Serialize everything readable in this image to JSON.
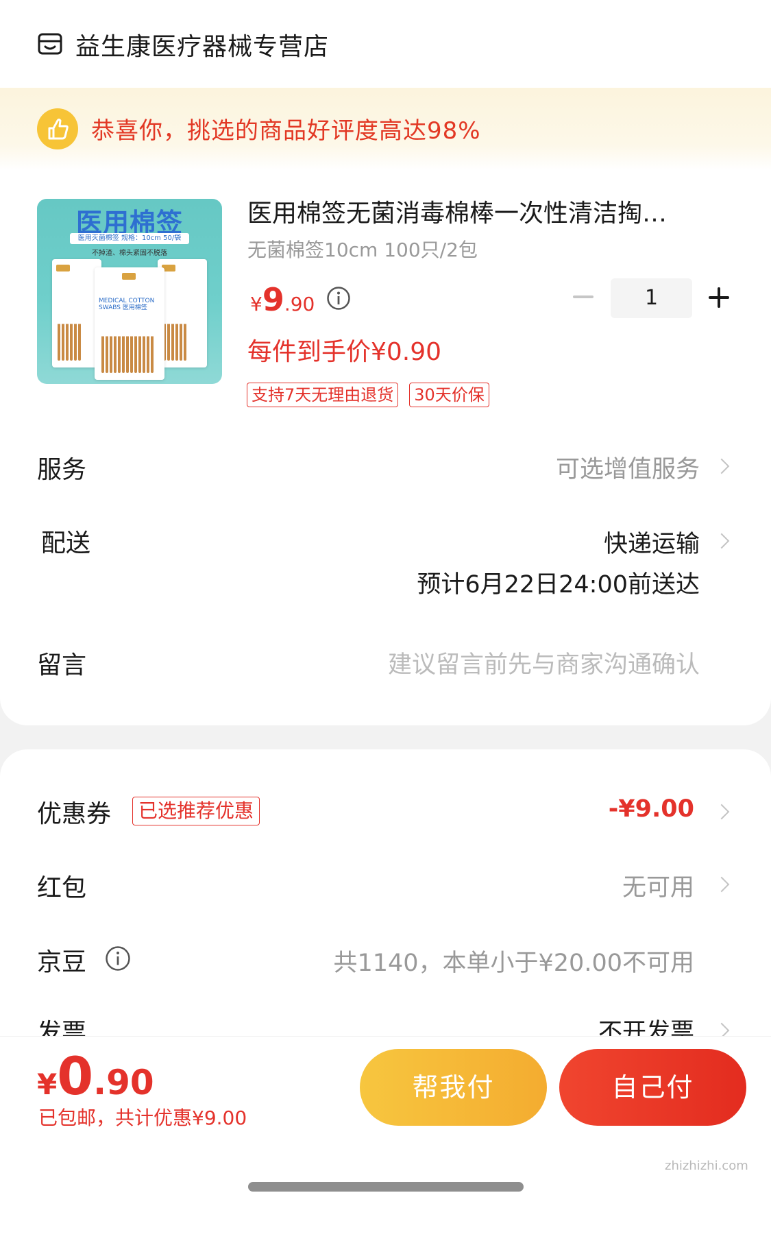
{
  "store": {
    "name": "益生康医疗器械专营店",
    "icon": "store-icon"
  },
  "praise": {
    "text": "恭喜你，挑选的商品好评度高达98%",
    "icon": "thumbs-up-icon"
  },
  "product": {
    "image_text": {
      "title": "医用棉签",
      "sub": "医用灭菌棉签  规格：10cm 50/袋",
      "sub2": "不掉渣、棉头紧固不脱落",
      "pack_label": "MEDICAL COTTON SWABS 医用棉签"
    },
    "title": "医用棉签无菌消毒棉棒一次性清洁掏…",
    "spec": "无菌棉签10cm 100只/2包",
    "price": {
      "currency": "¥",
      "integer": "9",
      "decimal": ".90"
    },
    "quantity": "1",
    "final_price": "每件到手价¥0.90",
    "tags": [
      "支持7天无理由退货",
      "30天价保"
    ]
  },
  "rows": {
    "service": {
      "label": "服务",
      "value": "可选增值服务"
    },
    "delivery": {
      "label": "配送",
      "value": "快递运输",
      "eta": "预计6月22日24:00前送达"
    },
    "message": {
      "label": "留言",
      "placeholder": "建议留言前先与商家沟通确认"
    }
  },
  "discounts": {
    "coupon": {
      "label": "优惠券",
      "tag": "已选推荐优惠",
      "value": "-¥9.00"
    },
    "red_packet": {
      "label": "红包",
      "value": "无可用"
    },
    "jingdou": {
      "label": "京豆",
      "value": "共1140，本单小于¥20.00不可用"
    },
    "invoice": {
      "label": "发票",
      "value": "不开发票"
    }
  },
  "footer": {
    "total": {
      "currency": "¥",
      "integer": "0",
      "decimal": ".90"
    },
    "note": "已包邮，共计优惠¥9.00",
    "help_pay": "帮我付",
    "self_pay": "自己付"
  },
  "watermark": "zhizhizhi.com",
  "colors": {
    "accent_red": "#e4322b",
    "yellow_button": "#f4ac30",
    "praise_bg": "#fcf4dd"
  }
}
